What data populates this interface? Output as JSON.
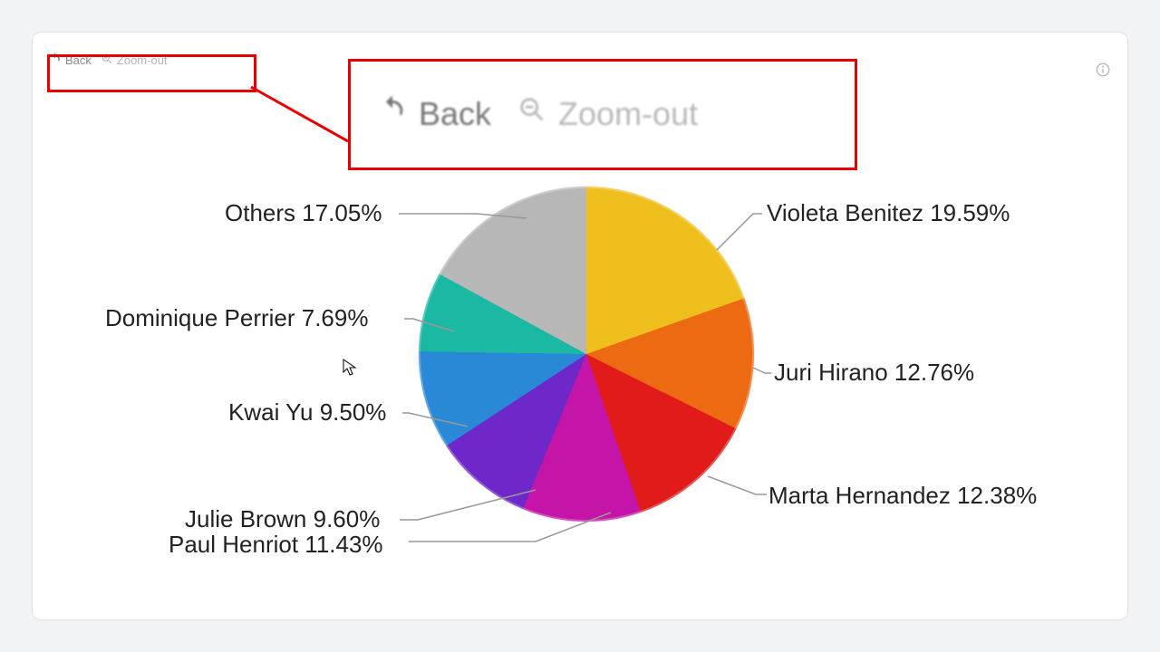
{
  "toolbar": {
    "back_label": "Back",
    "zoom_label": "Zoom-out"
  },
  "info_title": "Chart info",
  "chart_data": {
    "type": "pie",
    "title": "",
    "series": [
      {
        "name": "Violeta Benitez",
        "value": 19.59,
        "color": "#efbf1d"
      },
      {
        "name": "Juri Hirano",
        "value": 12.76,
        "color": "#ec6a12"
      },
      {
        "name": "Marta Hernandez",
        "value": 12.38,
        "color": "#e11a1a"
      },
      {
        "name": "Paul Henriot",
        "value": 11.43,
        "color": "#c515a8"
      },
      {
        "name": "Julie Brown",
        "value": 9.6,
        "color": "#6e27c9"
      },
      {
        "name": "Kwai Yu",
        "value": 9.5,
        "color": "#2a89d6"
      },
      {
        "name": "Dominique Perrier",
        "value": 7.69,
        "color": "#1bb9a3"
      },
      {
        "name": "Others",
        "value": 17.05,
        "color": "#b7b7b7"
      }
    ]
  },
  "labels": {
    "violeta": "Violeta Benitez 19.59%",
    "juri": "Juri Hirano 12.76%",
    "marta": "Marta Hernandez 12.38%",
    "paul": "Paul Henriot 11.43%",
    "julie": "Julie Brown 9.60%",
    "kwai": "Kwai Yu 9.50%",
    "dominique": "Dominique Perrier 7.69%",
    "others": "Others 17.05%"
  }
}
